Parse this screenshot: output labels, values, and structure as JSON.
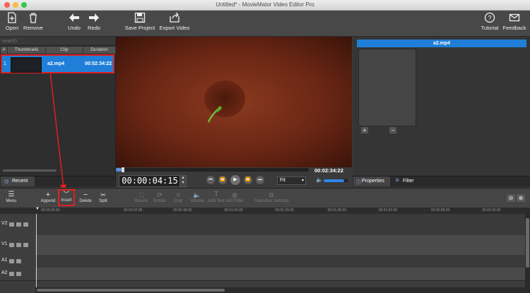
{
  "window": {
    "title": "Untitled* - MovieMator Video Editor Pro"
  },
  "toolbar": {
    "open": "Open",
    "remove": "Remove",
    "undo": "Undo",
    "redo": "Redo",
    "save_project": "Save Project",
    "export_video": "Export Video",
    "tutorial": "Tutorial",
    "feedback": "Feedback"
  },
  "playlist": {
    "search_placeholder": "search",
    "headers": {
      "index": "#",
      "thumbnails": "Thumbnails",
      "clip": "Clip",
      "duration": "Duration"
    },
    "rows": [
      {
        "index": "1",
        "clip": "a2.mp4",
        "duration": "00:02:34:22"
      }
    ],
    "tab_recent": "Recent"
  },
  "player": {
    "timecode": "00:00:04:15",
    "total_duration": "00:02:34:22",
    "zoom_select": "Fit",
    "progress": 0.03,
    "volume": 0.85
  },
  "properties": {
    "clip_title": "a2.mp4",
    "tab_properties": "Properties",
    "tab_filter": "Filter",
    "add": "+",
    "remove": "−"
  },
  "timeline_toolbar": {
    "menu": "Menu",
    "append": "Append",
    "insert": "Insert",
    "delete": "Delete",
    "split": "Split",
    "resize": "Resize",
    "rotate": "Rotate",
    "crop": "Crop",
    "volume": "Volume",
    "add_text": "Add Text",
    "add_filter": "Add Filter",
    "transition_settings": "Transition Settings"
  },
  "ruler": {
    "ticks": [
      "00:00:00:00",
      "00:00:32:00",
      "00:00:48:00",
      "00:01:04:00",
      "00:01:20:00",
      "00:01:36:00",
      "00:01:52:00",
      "00:02:08:00",
      "00:02:24:00"
    ]
  },
  "tracks": [
    {
      "name": "V2"
    },
    {
      "name": "V1"
    },
    {
      "name": "A1"
    },
    {
      "name": "A2"
    }
  ],
  "colors": {
    "accent": "#1f7fd8",
    "highlight": "#e02020"
  }
}
